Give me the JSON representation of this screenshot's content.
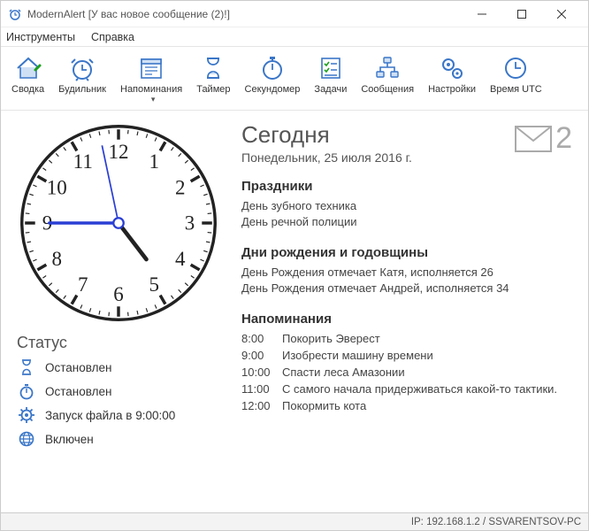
{
  "window": {
    "title": "ModernAlert [У вас новое сообщение (2)!]"
  },
  "menu": {
    "tools": "Инструменты",
    "help": "Справка"
  },
  "toolbar": {
    "summary": "Сводка",
    "alarm": "Будильник",
    "reminders": "Напоминания",
    "timer": "Таймер",
    "stopwatch": "Секундомер",
    "tasks": "Задачи",
    "messages": "Сообщения",
    "settings": "Настройки",
    "utc": "Время UTC"
  },
  "clock": {
    "hour": 4,
    "minute": 45,
    "second": 58
  },
  "status": {
    "heading": "Статус",
    "items": [
      {
        "icon": "hourglass",
        "text": "Остановлен"
      },
      {
        "icon": "stopwatch",
        "text": "Остановлен"
      },
      {
        "icon": "gear",
        "text": "Запуск файла в 9:00:00"
      },
      {
        "icon": "globe",
        "text": "Включен"
      }
    ]
  },
  "today": {
    "title": "Сегодня",
    "date": "Понедельник, 25 июля 2016 г.",
    "unread_count": "2"
  },
  "holidays": {
    "heading": "Праздники",
    "items": [
      "День зубного техника",
      "День речной полиции"
    ]
  },
  "birthdays": {
    "heading": "Дни рождения и годовщины",
    "items": [
      "День Рождения отмечает Катя, исполняется 26",
      "День Рождения отмечает Андрей, исполняется 34"
    ]
  },
  "reminders": {
    "heading": "Напоминания",
    "items": [
      {
        "time": "8:00",
        "text": "Покорить Эверест"
      },
      {
        "time": "9:00",
        "text": "Изобрести машину времени"
      },
      {
        "time": "10:00",
        "text": "Спасти леса Амазонии"
      },
      {
        "time": "11:00",
        "text": "С самого начала придерживаться какой-то тактики."
      },
      {
        "time": "12:00",
        "text": "Покормить кота"
      }
    ]
  },
  "statusbar": {
    "text": "IP: 192.168.1.2 / SSVARENTSOV-PC"
  },
  "colors": {
    "accent": "#3a76c8"
  }
}
